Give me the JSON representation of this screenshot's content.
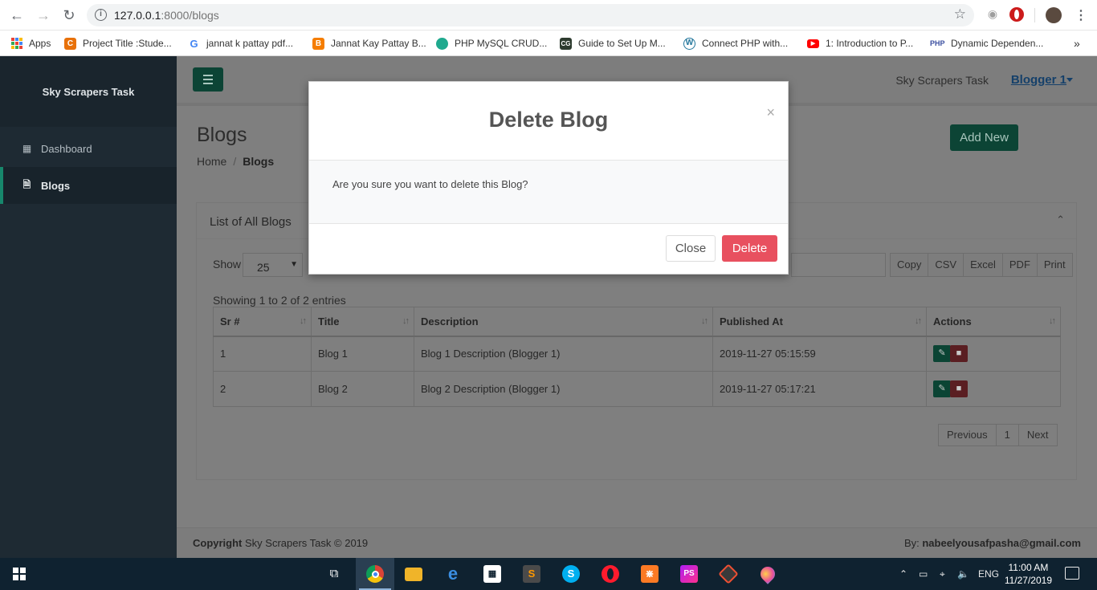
{
  "browser": {
    "url_host": "127.0.0.1",
    "url_rest": ":8000/blogs",
    "bookmarks": [
      {
        "label": "Apps",
        "icon": "apps-grid-icon"
      },
      {
        "label": "Project Title :Stude...",
        "icon": "c-logo-icon",
        "color": "#e8710a"
      },
      {
        "label": "jannat k pattay pdf...",
        "icon": "google-icon"
      },
      {
        "label": "Jannat Kay Pattay B...",
        "icon": "blogger-icon",
        "color": "#f57d00"
      },
      {
        "label": "PHP MySQL CRUD...",
        "icon": "hexagon-icon",
        "color": "#1fa98e"
      },
      {
        "label": "Guide to Set Up M...",
        "icon": "cg-icon",
        "color": "#2d3b2f"
      },
      {
        "label": "Connect PHP with...",
        "icon": "wordpress-icon",
        "color": "#21759b"
      },
      {
        "label": "1: Introduction to P...",
        "icon": "youtube-icon",
        "color": "#ff0000"
      },
      {
        "label": "Dynamic Dependen...",
        "icon": "php-icon",
        "color": "#3b4fa0"
      }
    ],
    "more": "»"
  },
  "sidebar": {
    "brand": "Sky Scrapers Task",
    "items": [
      {
        "label": "Dashboard",
        "icon": "dashboard-icon",
        "active": false
      },
      {
        "label": "Blogs",
        "icon": "file-icon",
        "active": true
      }
    ]
  },
  "topbar": {
    "site_title": "Sky Scrapers Task",
    "user": "Blogger 1"
  },
  "page": {
    "title": "Blogs",
    "breadcrumb_home": "Home",
    "breadcrumb_sep": "/",
    "breadcrumb_current": "Blogs",
    "add_new": "Add New"
  },
  "card": {
    "title": "List of All Blogs",
    "show_label": "Show",
    "page_size": "25",
    "export_buttons": [
      "Copy",
      "CSV",
      "Excel",
      "PDF",
      "Print"
    ],
    "showing_text": "Showing 1 to 2 of 2 entries",
    "columns": [
      "Sr #",
      "Title",
      "Description",
      "Published At",
      "Actions"
    ],
    "rows": [
      {
        "sr": "1",
        "title": "Blog 1",
        "description": "Blog 1 Description (Blogger 1)",
        "published": "2019-11-27 05:15:59"
      },
      {
        "sr": "2",
        "title": "Blog 2",
        "description": "Blog 2 Description (Blogger 1)",
        "published": "2019-11-27 05:17:21"
      }
    ],
    "pager": {
      "prev": "Previous",
      "page": "1",
      "next": "Next"
    }
  },
  "footer": {
    "copyright_bold": "Copyright",
    "copyright_rest": " Sky Scrapers Task © 2019",
    "by_label": "By: ",
    "by_email": "nabeelyousafpasha@gmail.com"
  },
  "modal": {
    "title": "Delete Blog",
    "close_x": "×",
    "message": "Are you sure you want to delete this Blog?",
    "close_button": "Close",
    "delete_button": "Delete",
    "delete_color": "#e8505f"
  },
  "taskbar": {
    "language": "ENG",
    "time": "11:00 AM",
    "date": "11/27/2019"
  }
}
